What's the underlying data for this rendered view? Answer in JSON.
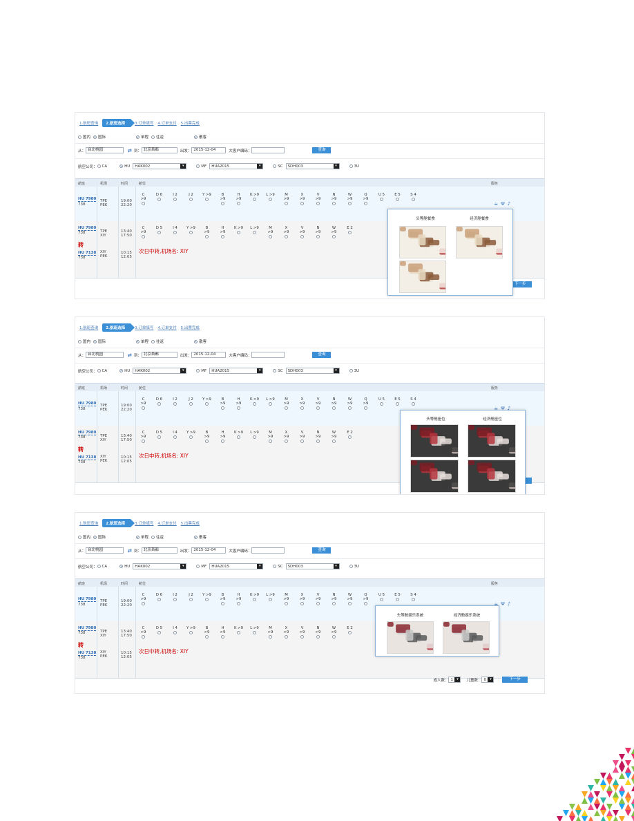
{
  "steps": [
    "1.航班查询",
    "2.航班选择",
    "3.订单填写",
    "4.订单支付",
    "5.出票完成"
  ],
  "search": {
    "domestic": "国内",
    "international": "国际",
    "oneway": "单程",
    "roundtrip": "往返",
    "passenger": "散客",
    "from_label": "从：",
    "from_value": "台北桃园",
    "to_label": "到：",
    "to_value": "北京首都",
    "depart_label": "出发：",
    "depart_value": "2015-12-04",
    "corp_label": "大客户编码：",
    "query_button": "查询"
  },
  "airline": {
    "label": "航空公司：",
    "codes": [
      "CA",
      "HU",
      "MF",
      "SC",
      "3U"
    ],
    "hu_select": "HAK002",
    "mf_select": "HUA2015",
    "sc_select": "SDH003"
  },
  "table": {
    "headers": [
      "航班",
      "机场",
      "时间",
      "舱位",
      "服务"
    ]
  },
  "flight1": {
    "no": "HU 7980",
    "type": "738",
    "from": "TPE",
    "to": "PEK",
    "dep": "19:00",
    "arr": "22:20",
    "cabins": [
      "C >9",
      "D 6",
      "I 2",
      "J 2",
      "Y >9",
      "B >9",
      "H >9",
      "K >9",
      "L >9",
      "M >9",
      "X >9",
      "V >9",
      "N >9",
      "W >9",
      "Q >9",
      "U 5",
      "E 5",
      "S 4"
    ]
  },
  "flight2": {
    "no1": "HU 7980",
    "type1": "738",
    "from1": "TPE",
    "to1": "XIY",
    "dep1": "13:40",
    "arr1": "17:50",
    "zhuan": "转",
    "no2": "HU 7138",
    "type2": "738",
    "from2": "XIY",
    "to2": "PEK",
    "dep2": "10:15",
    "arr2": "12:05",
    "transfer_note": "次日中转,机场名: XIY",
    "cabins": [
      "C >9",
      "D 5",
      "I 4",
      "Y >9",
      "B >9",
      "H >9",
      "K >9",
      "L >9",
      "M >9",
      "X >9",
      "V >9",
      "N >9",
      "W >9",
      "E 2"
    ]
  },
  "popups": {
    "meal": {
      "first": "头等舱餐食",
      "econ": "经济舱餐食"
    },
    "seat": {
      "first": "头等舱座位",
      "econ": "经济舱座位"
    },
    "ent": {
      "first": "头等舱娱乐系统",
      "econ": "经济舱娱乐系统"
    }
  },
  "footer": {
    "adults_label": "成人数：",
    "adults_value": "1",
    "children_label": "儿童数：",
    "children_value": "0",
    "next_button": "下一步"
  },
  "colors": {
    "accent": "#3a8fd6",
    "link": "#2d6cb5",
    "alert": "#cc0000"
  }
}
